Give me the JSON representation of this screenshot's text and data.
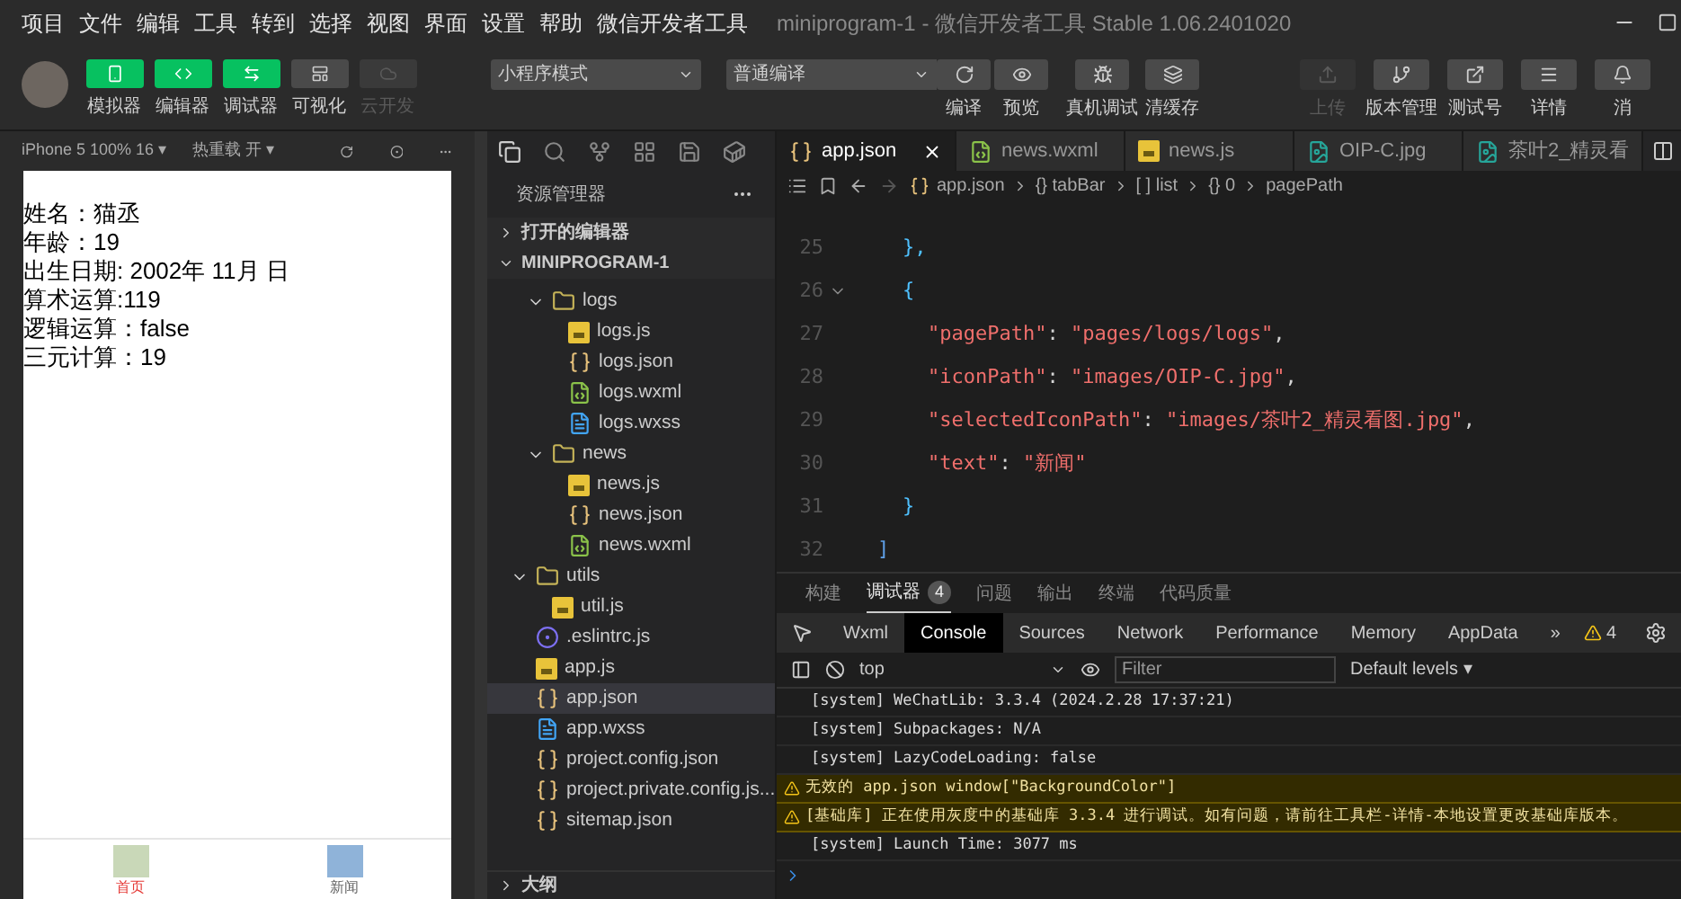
{
  "menu_bar": {
    "items": [
      "项目",
      "文件",
      "编辑",
      "工具",
      "转到",
      "选择",
      "视图",
      "界面",
      "设置",
      "帮助",
      "微信开发者工具"
    ],
    "title": "miniprogram-1 - 微信开发者工具 Stable 1.06.2401020"
  },
  "toolbar": {
    "view_toggles": [
      {
        "label": "模拟器",
        "on": true,
        "disabled": false
      },
      {
        "label": "编辑器",
        "on": true,
        "disabled": false
      },
      {
        "label": "调试器",
        "on": true,
        "disabled": false
      },
      {
        "label": "可视化",
        "on": false,
        "disabled": false
      },
      {
        "label": "云开发",
        "on": false,
        "disabled": true
      }
    ],
    "mode_select": "小程序模式",
    "compile_select": "普通编译",
    "actions": [
      "编译",
      "预览",
      "真机调试",
      "清缓存"
    ],
    "right_actions": [
      {
        "label": "上传",
        "disabled": true
      },
      {
        "label": "版本管理",
        "disabled": false
      },
      {
        "label": "测试号",
        "disabled": false
      },
      {
        "label": "详情",
        "disabled": false
      },
      {
        "label": "消",
        "disabled": false
      }
    ]
  },
  "simulator": {
    "device": "iPhone 5 100% 16 ▾",
    "hot_reload": "热重载 开 ▾",
    "lines": [
      "姓名：猫丞",
      "年龄：19",
      "出生日期: 2002年 11月 日",
      "算术运算:119",
      "逻辑运算：false",
      "三元计算：19"
    ],
    "tab_bar": [
      {
        "label": "首页",
        "selected": true
      },
      {
        "label": "新闻",
        "selected": false
      }
    ]
  },
  "explorer": {
    "title": "资源管理器",
    "sections": [
      {
        "label": "打开的编辑器",
        "expanded": false
      },
      {
        "label": "MINIPROGRAM-1",
        "expanded": true
      }
    ],
    "nested_items": [
      {
        "kind": "folder",
        "name": "logs",
        "expanded": true,
        "selected": false,
        "children": [
          {
            "kind": "js",
            "name": "logs.js",
            "selected": false
          },
          {
            "kind": "json",
            "name": "logs.json",
            "selected": false
          },
          {
            "kind": "wxml",
            "name": "logs.wxml",
            "selected": false
          },
          {
            "kind": "wxss",
            "name": "logs.wxss",
            "selected": false
          }
        ]
      },
      {
        "kind": "folder",
        "name": "news",
        "expanded": true,
        "selected": false,
        "children": [
          {
            "kind": "js",
            "name": "news.js",
            "selected": false
          },
          {
            "kind": "json",
            "name": "news.json",
            "selected": false
          },
          {
            "kind": "wxml",
            "name": "news.wxml",
            "selected": false
          }
        ]
      }
    ],
    "items": [
      {
        "kind": "folder",
        "name": "utils",
        "expanded": true,
        "selected": false,
        "children": [
          {
            "kind": "js",
            "name": "util.js",
            "selected": false
          }
        ]
      },
      {
        "kind": "eslint",
        "name": ".eslintrc.js",
        "selected": false
      },
      {
        "kind": "js",
        "name": "app.js",
        "selected": false
      },
      {
        "kind": "json",
        "name": "app.json",
        "selected": true
      },
      {
        "kind": "wxss",
        "name": "app.wxss",
        "selected": false
      },
      {
        "kind": "json",
        "name": "project.config.json",
        "selected": false
      },
      {
        "kind": "json",
        "name": "project.private.config.js...",
        "selected": false
      },
      {
        "kind": "json",
        "name": "sitemap.json",
        "selected": false
      }
    ],
    "outline": {
      "label": "大纲",
      "expanded": false
    }
  },
  "editor": {
    "tabs": [
      {
        "kind": "json",
        "label": "app.json",
        "selected": true
      },
      {
        "kind": "wxml",
        "label": "news.wxml",
        "selected": false
      },
      {
        "kind": "js",
        "label": "news.js",
        "selected": false
      },
      {
        "kind": "image",
        "label": "OIP-C.jpg",
        "selected": false
      },
      {
        "kind": "image",
        "label": "茶叶2_精灵看",
        "selected": false
      }
    ],
    "breadcrumb": [
      "app.json",
      "{} tabBar",
      "[ ] list",
      "{} 0",
      "pagePath"
    ],
    "lines": [
      {
        "number": "25",
        "foldable": false,
        "tokens": [
          {
            "kind": "brace",
            "text": "},"
          }
        ]
      },
      {
        "number": "26",
        "foldable": true,
        "tokens": [
          {
            "kind": "brace",
            "text": "{"
          }
        ]
      },
      {
        "number": "27",
        "foldable": false,
        "tokens": [
          {
            "kind": "key",
            "text": "\"pagePath\""
          },
          {
            "kind": "punct",
            "text": ": "
          },
          {
            "kind": "string",
            "text": "\"pages/logs/logs\""
          },
          {
            "kind": "punct",
            "text": ","
          }
        ]
      },
      {
        "number": "28",
        "foldable": false,
        "tokens": [
          {
            "kind": "key",
            "text": "\"iconPath\""
          },
          {
            "kind": "punct",
            "text": ": "
          },
          {
            "kind": "string",
            "text": "\"images/OIP-C.jpg\""
          },
          {
            "kind": "punct",
            "text": ","
          }
        ]
      },
      {
        "number": "29",
        "foldable": false,
        "tokens": [
          {
            "kind": "key",
            "text": "\"selectedIconPath\""
          },
          {
            "kind": "punct",
            "text": ": "
          },
          {
            "kind": "string",
            "text": "\"images/茶叶2_精灵看图.jpg\""
          },
          {
            "kind": "punct",
            "text": ","
          }
        ]
      },
      {
        "number": "30",
        "foldable": false,
        "tokens": [
          {
            "kind": "key",
            "text": "\"text\""
          },
          {
            "kind": "punct",
            "text": ": "
          },
          {
            "kind": "string",
            "text": "\"新闻\""
          }
        ]
      },
      {
        "number": "31",
        "foldable": false,
        "tokens": [
          {
            "kind": "brace",
            "text": "}"
          }
        ]
      },
      {
        "number": "32",
        "foldable": false,
        "tokens": [
          {
            "kind": "bracket",
            "text": "]"
          }
        ]
      }
    ]
  },
  "panel": {
    "tabs": [
      {
        "label": "构建",
        "selected": false
      },
      {
        "label": "调试器",
        "selected": true,
        "badge": "4"
      },
      {
        "label": "问题",
        "selected": false
      },
      {
        "label": "输出",
        "selected": false
      },
      {
        "label": "终端",
        "selected": false
      },
      {
        "label": "代码质量",
        "selected": false
      }
    ],
    "devtools_tabs": [
      {
        "label": "Wxml",
        "selected": false
      },
      {
        "label": "Console",
        "selected": true
      },
      {
        "label": "Sources",
        "selected": false
      },
      {
        "label": "Network",
        "selected": false
      },
      {
        "label": "Performance",
        "selected": false
      },
      {
        "label": "Memory",
        "selected": false
      },
      {
        "label": "AppData",
        "selected": false
      },
      {
        "label": "»",
        "selected": false
      }
    ],
    "warning_count": "4",
    "context": "top",
    "filter": {
      "placeholder": "Filter"
    },
    "levels": "Default levels ▾",
    "logs": [
      {
        "kind": "system",
        "text": "[system] WeChatLib: 3.3.4 (2024.2.28 17:37:21)"
      },
      {
        "kind": "system",
        "text": "[system] Subpackages: N/A"
      },
      {
        "kind": "system",
        "text": "[system] LazyCodeLoading: false"
      },
      {
        "kind": "warning",
        "text": "无效的 app.json window[\"BackgroundColor\"]"
      },
      {
        "kind": "warning",
        "text": "[基础库] 正在使用灰度中的基础库 3.3.4 进行调试。如有问题，请前往工具栏-详情-本地设置更改基础库版本。"
      },
      {
        "kind": "system",
        "text": "[system] Launch Time: 3077 ms"
      }
    ]
  }
}
